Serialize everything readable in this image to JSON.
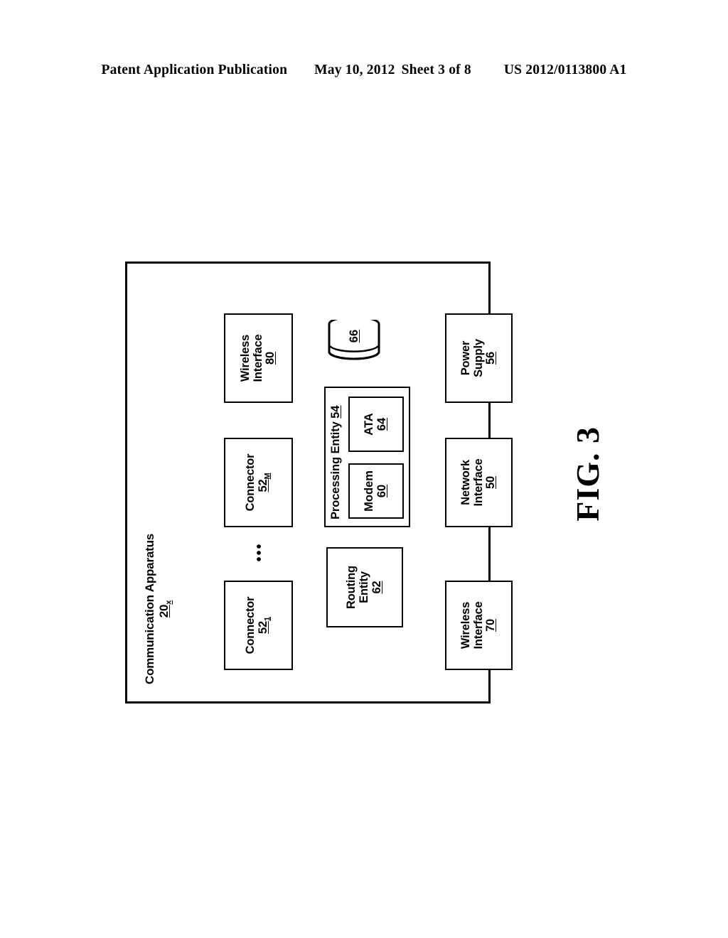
{
  "header": {
    "publication": "Patent Application Publication",
    "date": "May 10, 2012",
    "sheet": "Sheet 3 of 8",
    "document_number": "US 2012/0113800 A1"
  },
  "figure": {
    "caption": "FIG. 3",
    "apparatus": {
      "title": "Communication Apparatus",
      "ref": "20",
      "ref_subscript": "x"
    },
    "ellipsis": "•••",
    "blocks": [
      {
        "id": "connector-1",
        "line1": "Connector",
        "line2": "",
        "ref": "52",
        "ref_subscript": "1"
      },
      {
        "id": "connector-m",
        "line1": "Connector",
        "line2": "",
        "ref": "52",
        "ref_subscript": "M"
      },
      {
        "id": "wireless-80",
        "line1": "Wireless",
        "line2": "Interface",
        "ref": "80",
        "ref_subscript": ""
      },
      {
        "id": "routing-62",
        "line1": "Routing",
        "line2": "Entity",
        "ref": "62",
        "ref_subscript": ""
      },
      {
        "id": "wireless-70",
        "line1": "Wireless",
        "line2": "Interface",
        "ref": "70",
        "ref_subscript": ""
      },
      {
        "id": "network-50",
        "line1": "Network",
        "line2": "Interface",
        "ref": "50",
        "ref_subscript": ""
      },
      {
        "id": "power-56",
        "line1": "Power",
        "line2": "Supply",
        "ref": "56",
        "ref_subscript": ""
      }
    ],
    "processing_entity": {
      "label": "Processing Entity",
      "ref": "54",
      "children": [
        {
          "id": "modem-60",
          "line1": "Modem",
          "ref": "60"
        },
        {
          "id": "ata-64",
          "line1": "ATA",
          "ref": "64"
        }
      ]
    },
    "data_store": {
      "id": "store-66",
      "ref": "66"
    }
  },
  "colors": {
    "ink": "#000000",
    "paper": "#ffffff"
  }
}
